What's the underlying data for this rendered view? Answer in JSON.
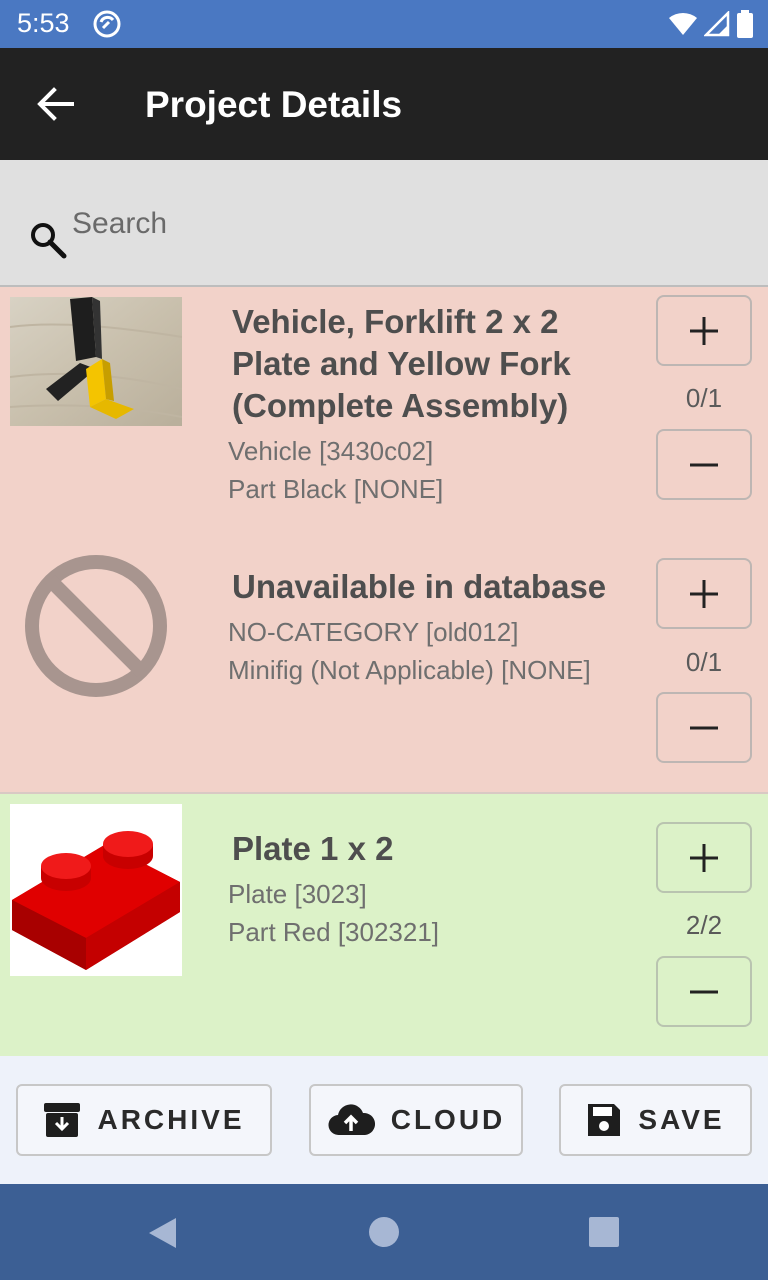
{
  "status_bar": {
    "time": "5:53"
  },
  "app_bar": {
    "title": "Project Details"
  },
  "search": {
    "placeholder": "Search"
  },
  "parts": [
    {
      "name": "Vehicle, Forklift 2 x 2 Plate and Yellow Fork (Complete Assembly)",
      "category": "Vehicle [3430c02]",
      "color": "Part Black [NONE]",
      "count": "0/1",
      "status": "incomplete"
    },
    {
      "name": "Unavailable in database",
      "category": "NO-CATEGORY [old012]",
      "color": "Minifig (Not Applicable) [NONE]",
      "count": "0/1",
      "status": "incomplete"
    },
    {
      "name": "Plate 1 x 2",
      "category": "Plate [3023]",
      "color": "Part Red [302321]",
      "count": "2/2",
      "status": "complete"
    }
  ],
  "actions": {
    "archive": "ARCHIVE",
    "cloud": "CLOUD",
    "save": "SAVE"
  },
  "colors": {
    "status_bar": "#4a78c2",
    "app_bar": "#222222",
    "incomplete_row": "#f2d2c9",
    "complete_row": "#dcf2c8",
    "nav_bar": "#3c5f94"
  }
}
